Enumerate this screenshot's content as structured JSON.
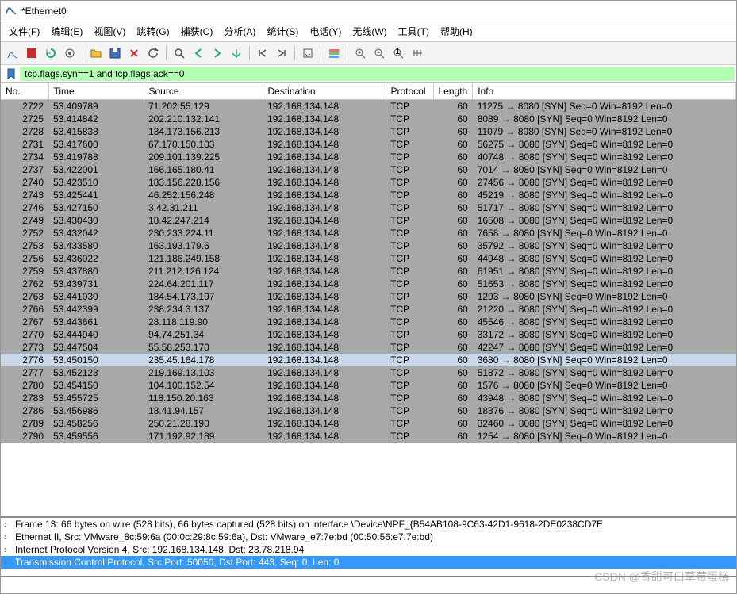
{
  "title": "*Ethernet0",
  "menu": [
    "文件(F)",
    "编辑(E)",
    "视图(V)",
    "跳转(G)",
    "捕获(C)",
    "分析(A)",
    "统计(S)",
    "电话(Y)",
    "无线(W)",
    "工具(T)",
    "帮助(H)"
  ],
  "filter": "tcp.flags.syn==1 and tcp.flags.ack==0",
  "cols": {
    "no": "No.",
    "time": "Time",
    "src": "Source",
    "dst": "Destination",
    "proto": "Protocol",
    "len": "Length",
    "info": "Info"
  },
  "selected_no": "2776",
  "packets": [
    {
      "no": "2722",
      "time": "53.409789",
      "src": "71.202.55.129",
      "dst": "192.168.134.148",
      "proto": "TCP",
      "len": "60",
      "info": "11275 → 8080 [SYN] Seq=0 Win=8192 Len=0"
    },
    {
      "no": "2725",
      "time": "53.414842",
      "src": "202.210.132.141",
      "dst": "192.168.134.148",
      "proto": "TCP",
      "len": "60",
      "info": "8089 → 8080 [SYN] Seq=0 Win=8192 Len=0"
    },
    {
      "no": "2728",
      "time": "53.415838",
      "src": "134.173.156.213",
      "dst": "192.168.134.148",
      "proto": "TCP",
      "len": "60",
      "info": "11079 → 8080 [SYN] Seq=0 Win=8192 Len=0"
    },
    {
      "no": "2731",
      "time": "53.417600",
      "src": "67.170.150.103",
      "dst": "192.168.134.148",
      "proto": "TCP",
      "len": "60",
      "info": "56275 → 8080 [SYN] Seq=0 Win=8192 Len=0"
    },
    {
      "no": "2734",
      "time": "53.419788",
      "src": "209.101.139.225",
      "dst": "192.168.134.148",
      "proto": "TCP",
      "len": "60",
      "info": "40748 → 8080 [SYN] Seq=0 Win=8192 Len=0"
    },
    {
      "no": "2737",
      "time": "53.422001",
      "src": "166.165.180.41",
      "dst": "192.168.134.148",
      "proto": "TCP",
      "len": "60",
      "info": "7014 → 8080 [SYN] Seq=0 Win=8192 Len=0"
    },
    {
      "no": "2740",
      "time": "53.423510",
      "src": "183.156.228.156",
      "dst": "192.168.134.148",
      "proto": "TCP",
      "len": "60",
      "info": "27456 → 8080 [SYN] Seq=0 Win=8192 Len=0"
    },
    {
      "no": "2743",
      "time": "53.425441",
      "src": "46.252.156.248",
      "dst": "192.168.134.148",
      "proto": "TCP",
      "len": "60",
      "info": "45219 → 8080 [SYN] Seq=0 Win=8192 Len=0"
    },
    {
      "no": "2746",
      "time": "53.427150",
      "src": "3.42.31.211",
      "dst": "192.168.134.148",
      "proto": "TCP",
      "len": "60",
      "info": "51717 → 8080 [SYN] Seq=0 Win=8192 Len=0"
    },
    {
      "no": "2749",
      "time": "53.430430",
      "src": "18.42.247.214",
      "dst": "192.168.134.148",
      "proto": "TCP",
      "len": "60",
      "info": "16508 → 8080 [SYN] Seq=0 Win=8192 Len=0"
    },
    {
      "no": "2752",
      "time": "53.432042",
      "src": "230.233.224.11",
      "dst": "192.168.134.148",
      "proto": "TCP",
      "len": "60",
      "info": "7658 → 8080 [SYN] Seq=0 Win=8192 Len=0"
    },
    {
      "no": "2753",
      "time": "53.433580",
      "src": "163.193.179.6",
      "dst": "192.168.134.148",
      "proto": "TCP",
      "len": "60",
      "info": "35792 → 8080 [SYN] Seq=0 Win=8192 Len=0"
    },
    {
      "no": "2756",
      "time": "53.436022",
      "src": "121.186.249.158",
      "dst": "192.168.134.148",
      "proto": "TCP",
      "len": "60",
      "info": "44948 → 8080 [SYN] Seq=0 Win=8192 Len=0"
    },
    {
      "no": "2759",
      "time": "53.437880",
      "src": "211.212.126.124",
      "dst": "192.168.134.148",
      "proto": "TCP",
      "len": "60",
      "info": "61951 → 8080 [SYN] Seq=0 Win=8192 Len=0"
    },
    {
      "no": "2762",
      "time": "53.439731",
      "src": "224.64.201.117",
      "dst": "192.168.134.148",
      "proto": "TCP",
      "len": "60",
      "info": "51653 → 8080 [SYN] Seq=0 Win=8192 Len=0"
    },
    {
      "no": "2763",
      "time": "53.441030",
      "src": "184.54.173.197",
      "dst": "192.168.134.148",
      "proto": "TCP",
      "len": "60",
      "info": "1293 → 8080 [SYN] Seq=0 Win=8192 Len=0"
    },
    {
      "no": "2766",
      "time": "53.442399",
      "src": "238.234.3.137",
      "dst": "192.168.134.148",
      "proto": "TCP",
      "len": "60",
      "info": "21220 → 8080 [SYN] Seq=0 Win=8192 Len=0"
    },
    {
      "no": "2767",
      "time": "53.443661",
      "src": "28.118.119.90",
      "dst": "192.168.134.148",
      "proto": "TCP",
      "len": "60",
      "info": "45546 → 8080 [SYN] Seq=0 Win=8192 Len=0"
    },
    {
      "no": "2770",
      "time": "53.444940",
      "src": "94.74.251.34",
      "dst": "192.168.134.148",
      "proto": "TCP",
      "len": "60",
      "info": "33172 → 8080 [SYN] Seq=0 Win=8192 Len=0"
    },
    {
      "no": "2773",
      "time": "53.447504",
      "src": "55.58.253.170",
      "dst": "192.168.134.148",
      "proto": "TCP",
      "len": "60",
      "info": "42247 → 8080 [SYN] Seq=0 Win=8192 Len=0"
    },
    {
      "no": "2776",
      "time": "53.450150",
      "src": "235.45.164.178",
      "dst": "192.168.134.148",
      "proto": "TCP",
      "len": "60",
      "info": "3680 → 8080 [SYN] Seq=0 Win=8192 Len=0"
    },
    {
      "no": "2777",
      "time": "53.452123",
      "src": "219.169.13.103",
      "dst": "192.168.134.148",
      "proto": "TCP",
      "len": "60",
      "info": "51872 → 8080 [SYN] Seq=0 Win=8192 Len=0"
    },
    {
      "no": "2780",
      "time": "53.454150",
      "src": "104.100.152.54",
      "dst": "192.168.134.148",
      "proto": "TCP",
      "len": "60",
      "info": "1576 → 8080 [SYN] Seq=0 Win=8192 Len=0"
    },
    {
      "no": "2783",
      "time": "53.455725",
      "src": "118.150.20.163",
      "dst": "192.168.134.148",
      "proto": "TCP",
      "len": "60",
      "info": "43948 → 8080 [SYN] Seq=0 Win=8192 Len=0"
    },
    {
      "no": "2786",
      "time": "53.456986",
      "src": "18.41.94.157",
      "dst": "192.168.134.148",
      "proto": "TCP",
      "len": "60",
      "info": "18376 → 8080 [SYN] Seq=0 Win=8192 Len=0"
    },
    {
      "no": "2789",
      "time": "53.458256",
      "src": "250.21.28.190",
      "dst": "192.168.134.148",
      "proto": "TCP",
      "len": "60",
      "info": "32460 → 8080 [SYN] Seq=0 Win=8192 Len=0"
    },
    {
      "no": "2790",
      "time": "53.459556",
      "src": "171.192.92.189",
      "dst": "192.168.134.148",
      "proto": "TCP",
      "len": "60",
      "info": "1254 → 8080 [SYN] Seq=0 Win=8192 Len=0"
    }
  ],
  "details": [
    "Frame 13: 66 bytes on wire (528 bits), 66 bytes captured (528 bits) on interface \\Device\\NPF_{B54AB108-9C63-42D1-9618-2DE0238CD7E",
    "Ethernet II, Src: VMware_8c:59:6a (00:0c:29:8c:59:6a), Dst: VMware_e7:7e:bd (00:50:56:e7:7e:bd)",
    "Internet Protocol Version 4, Src: 192.168.134.148, Dst: 23.78.218.94",
    "Transmission Control Protocol, Src Port: 50050, Dst Port: 443, Seq: 0, Len: 0"
  ],
  "watermark": "CSDN @香甜可口草莓蛋糕"
}
